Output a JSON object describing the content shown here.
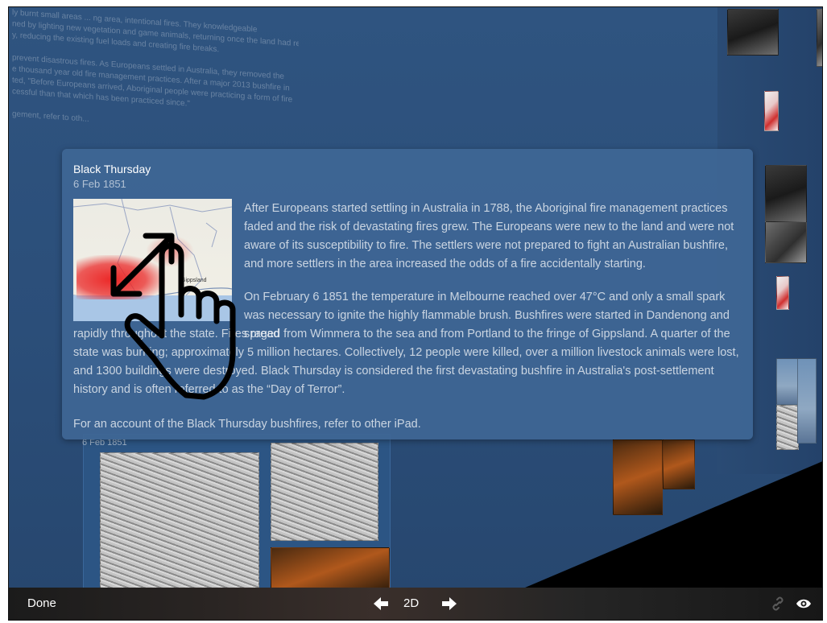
{
  "background": {
    "wall_text_lines": [
      "ly burnt small areas ... ng area, intentional fires. They knowledgeable",
      "ned by lighting new vegetation and game animals, returning once the land had recovered and",
      "y, reducing the existing fuel loads and creating fire breaks.",
      "",
      "prevent disastrous fires. As Europeans settled in Australia, they removed the",
      "e thousand year old fire management practices. After a major 2013 bushfire in",
      "ted, \"Before Europeans arrived, Aboriginal people were practicing a form of fire",
      "cessful than that which has been practiced since.\"",
      "",
      "gement, refer to oth..."
    ],
    "lower_panel_date": "6 Feb 1851"
  },
  "card": {
    "title": "Black Thursday",
    "date": "6 Feb 1851",
    "map_label": "Gippsland",
    "paragraph1": "After Europeans started settling in Australia in 1788, the Aboriginal fire management practices faded and the risk of devastating fires grew. The Europeans were new to the land and were not aware of its susceptibility to fire. The settlers were not prepared to fight an Australian bushfire, and more settlers in the area increased the odds of a fire accidentally starting.",
    "paragraph2_start": "On February 6 1851 the temperature in Melbourne reached over 47°C and only a small spark was necessary to ignite the highly flammable brush. Bushfires were started in Dandenong and spread",
    "paragraph2_rest": "rapidly throughout the state. Fires raged from Wimmera to the sea and from Portland to the fringe of Gippsland. A quarter of the state was burning; approximately 5 million hectares. Collectively, 12 people were killed, over a million livestock animals were lost, and 1300 buildings were destroyed. Black Thursday is considered the first devastating bushfire in Australia's post-settlement history and is often referred to as the “Day of Terror”.",
    "paragraph3": "For an account of the Black Thursday bushfires, refer to other iPad."
  },
  "toolbar": {
    "done_label": "Done",
    "view_mode_label": "2D",
    "prev_icon": "arrow-left-icon",
    "next_icon": "arrow-right-icon",
    "link_icon": "link-icon",
    "eye_icon": "eye-icon"
  },
  "gesture": {
    "icon": "pinch-zoom-hand-icon"
  }
}
